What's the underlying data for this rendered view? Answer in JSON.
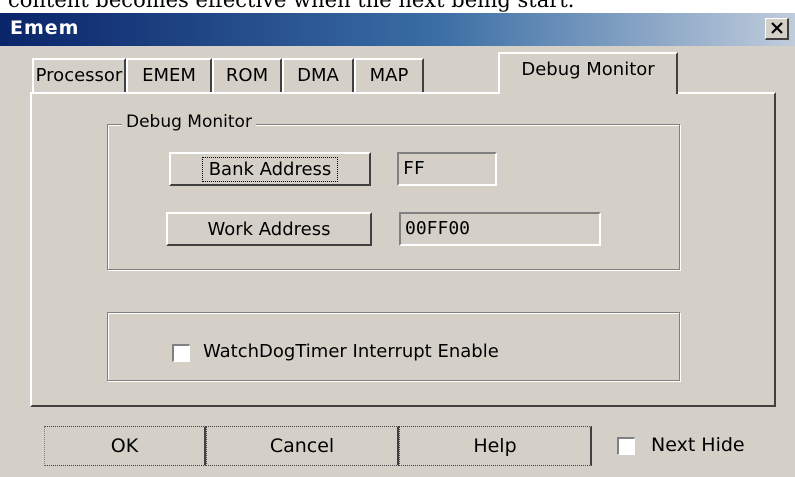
{
  "doc_caption": "content becomes effective when the next being start.",
  "window": {
    "title": "Emem",
    "close_symbol": "×"
  },
  "tabs": [
    {
      "label": "Processor",
      "active": false
    },
    {
      "label": "EMEM",
      "active": false
    },
    {
      "label": "ROM",
      "active": false
    },
    {
      "label": "DMA",
      "active": false
    },
    {
      "label": "MAP",
      "active": false
    },
    {
      "label": "Debug Monitor",
      "active": true
    }
  ],
  "debug_monitor_group": {
    "label": "Debug Monitor",
    "bank_address_button": "Bank Address",
    "bank_address_value": "FF",
    "work_address_button": "Work Address",
    "work_address_value": "00FF00"
  },
  "watchdog": {
    "label": "WatchDogTimer Interrupt Enable",
    "checked": false
  },
  "footer": {
    "ok_label": "OK",
    "cancel_label": "Cancel",
    "help_label": "Help",
    "next_hide_label": "Next Hide",
    "next_hide_checked": false
  },
  "colors": {
    "dialog_bg": "#d4d0c8",
    "titlebar_start": "#0a246a",
    "titlebar_end": "#c0ccdc"
  }
}
